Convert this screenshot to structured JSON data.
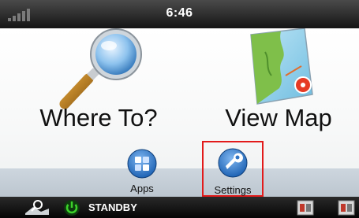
{
  "status_bar": {
    "time": "6:46"
  },
  "main": {
    "where_to_label": "Where To?",
    "view_map_label": "View Map"
  },
  "dock": {
    "apps_label": "Apps",
    "settings_label": "Settings"
  },
  "bottom_bar": {
    "standby_label": "STANDBY"
  },
  "colors": {
    "highlight_border": "#e21b1b",
    "standby_green": "#3cd22a",
    "icon_blue": "#1e63b4"
  }
}
